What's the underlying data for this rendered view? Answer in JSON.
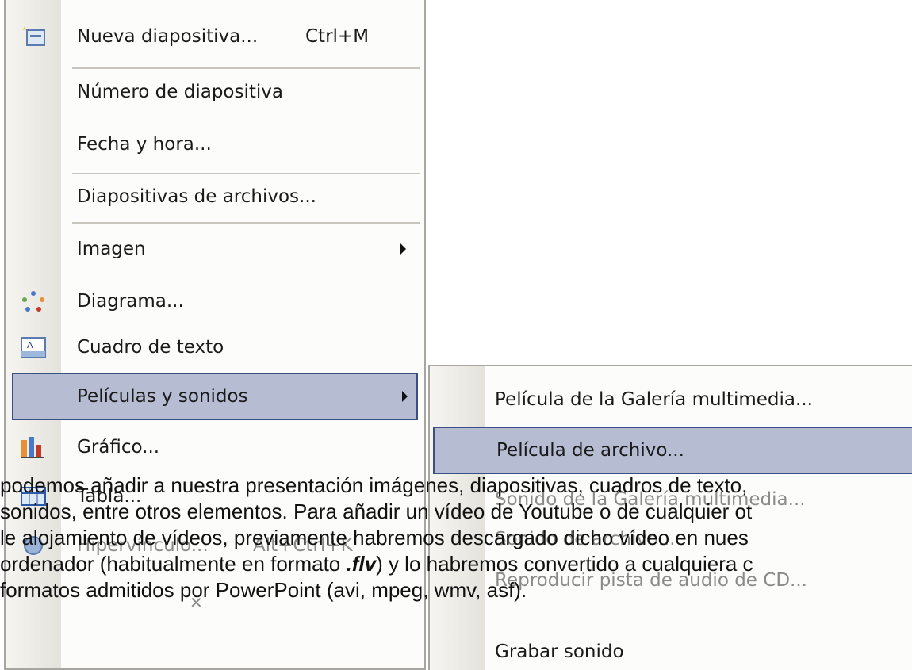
{
  "menu": {
    "items": [
      {
        "label": "Nueva diapositiva...",
        "shortcut": "Ctrl+M",
        "icon": "new-slide-icon"
      },
      {
        "label": "Número de diapositiva"
      },
      {
        "label": "Fecha y hora..."
      },
      {
        "label": "Diapositivas de archivos..."
      },
      {
        "label": "Imagen",
        "submenu": true
      },
      {
        "label": "Diagrama...",
        "icon": "diagram-icon"
      },
      {
        "label": "Cuadro de texto",
        "icon": "text-box-icon"
      },
      {
        "label": "Películas y sonidos",
        "submenu": true,
        "selected": true
      },
      {
        "label": "Gráfico...",
        "icon": "chart-icon"
      },
      {
        "label": "Tabla...",
        "icon": "table-icon"
      },
      {
        "label": "Hipervínculo...",
        "shortcut": "Alt+Ctrl+K"
      }
    ]
  },
  "submenu": {
    "items": [
      {
        "label": "Película de la Galería multimedia..."
      },
      {
        "label": "Película de archivo...",
        "selected": true
      },
      {
        "label": "Sonido de la Galería multimedia..."
      },
      {
        "label": "Sonido de archivo..."
      },
      {
        "label": "Reproducir pista de audio de CD..."
      },
      {
        "label": "Grabar sonido"
      }
    ]
  },
  "caption": {
    "line1": "podemos añadir a nuestra presentación imágenes, diapositivas, cuadros de texto,",
    "line2": "sonidos, entre otros elementos. Para añadir un vídeo de Youtube o de cualquier ot",
    "line3": "le alojamiento de vídeos, previamente habremos descargado dicho vídeo en nues",
    "line4a": "ordenador (habitualmente en formato ",
    "line4b": ".flv",
    "line4c": ") y lo habremos convertido a cualquiera c",
    "line5": "formatos admitidos por PowerPoint (avi, mpeg, wmv, asf)."
  },
  "colors": {
    "highlight_bg": "#b6bdd2",
    "highlight_border": "#3a4f86",
    "gutter": "#e4e2db"
  }
}
